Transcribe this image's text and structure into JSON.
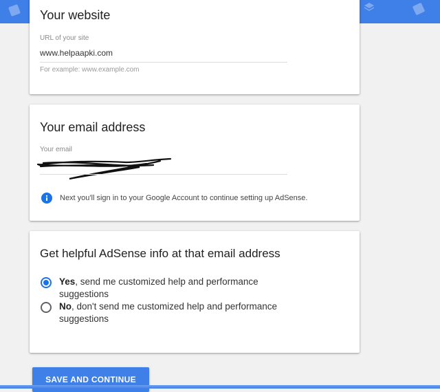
{
  "website_card": {
    "title": "Your website",
    "url_label": "URL of your site",
    "url_value": "www.helpaapki.com",
    "url_hint": "For example: www.example.com"
  },
  "email_card": {
    "title": "Your email address",
    "email_label": "Your email",
    "info_text": "Next you'll sign in to your Google Account to continue setting up AdSense."
  },
  "info_card": {
    "title": "Get helpful AdSense info at that email address",
    "options": [
      {
        "strong": "Yes",
        "rest": ", send me customized help and performance suggestions",
        "selected": true
      },
      {
        "strong": "No",
        "rest": ", don't send me customized help and performance suggestions",
        "selected": false
      }
    ]
  },
  "actions": {
    "save_label": "SAVE AND CONTINUE"
  },
  "colors": {
    "accent": "#3f7fe8",
    "radio_selected": "#1a73e8",
    "info_icon": "#1a73e8"
  },
  "icons": [
    "adsense-logo-icon",
    "layers-icon",
    "info-icon"
  ]
}
